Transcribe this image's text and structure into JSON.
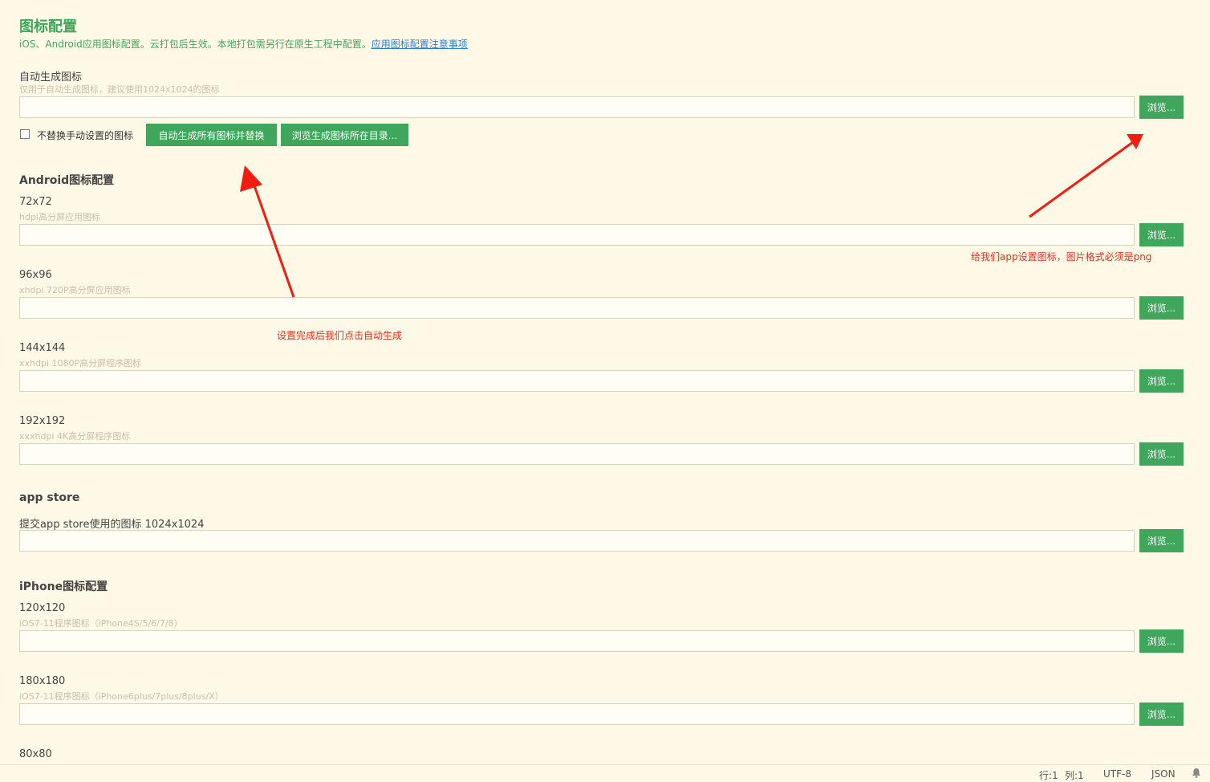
{
  "header": {
    "title": "图标配置",
    "description": "iOS、Android应用图标配置。云打包后生效。本地打包需另行在原生工程中配置。",
    "notes_link": "应用图标配置注意事项"
  },
  "auto": {
    "label": "自动生成图标",
    "hint": "仅用于自动生成图标，建议使用1024x1024的图标",
    "value": "",
    "browse": "浏览...",
    "checkbox_label": "不替换手动设置的图标",
    "checkbox_checked": false,
    "generate_button": "自动生成所有图标并替换",
    "open_dir_button": "浏览生成图标所在目录..."
  },
  "android": {
    "section_title": "Android图标配置",
    "items": [
      {
        "size": "72x72",
        "hint": "hdpi高分屏应用图标",
        "value": "",
        "browse": "浏览..."
      },
      {
        "size": "96x96",
        "hint": "xhdpi 720P高分屏应用图标",
        "value": "",
        "browse": "浏览..."
      },
      {
        "size": "144x144",
        "hint": "xxhdpi 1080P高分屏程序图标",
        "value": "",
        "browse": "浏览..."
      },
      {
        "size": "192x192",
        "hint": "xxxhdpi 4K高分屏程序图标",
        "value": "",
        "browse": "浏览..."
      }
    ]
  },
  "appstore": {
    "section_title": "app store",
    "label": "提交app store使用的图标 1024x1024",
    "value": "",
    "browse": "浏览..."
  },
  "iphone": {
    "section_title": "iPhone图标配置",
    "items": [
      {
        "size": "120x120",
        "hint": "iOS7-11程序图标（iPhone4S/5/6/7/8）",
        "value": "",
        "browse": "浏览..."
      },
      {
        "size": "180x180",
        "hint": "iOS7-11程序图标（iPhone6plus/7plus/8plus/X）",
        "value": "",
        "browse": "浏览..."
      },
      {
        "size": "80x80",
        "hint": "",
        "value": "",
        "browse": ""
      }
    ]
  },
  "annotations": {
    "left": "设置完成后我们点击自动生成",
    "right": "给我们app设置图标，图片格式必须是png",
    "color": "#e03020"
  },
  "statusbar": {
    "line": "行:1",
    "column": "列:1",
    "encoding": "UTF-8",
    "language": "JSON",
    "notification_icon": "bell-icon"
  },
  "colors": {
    "accent": "#3fa65c",
    "background": "#fef9e6",
    "link": "#2a7fd4"
  }
}
